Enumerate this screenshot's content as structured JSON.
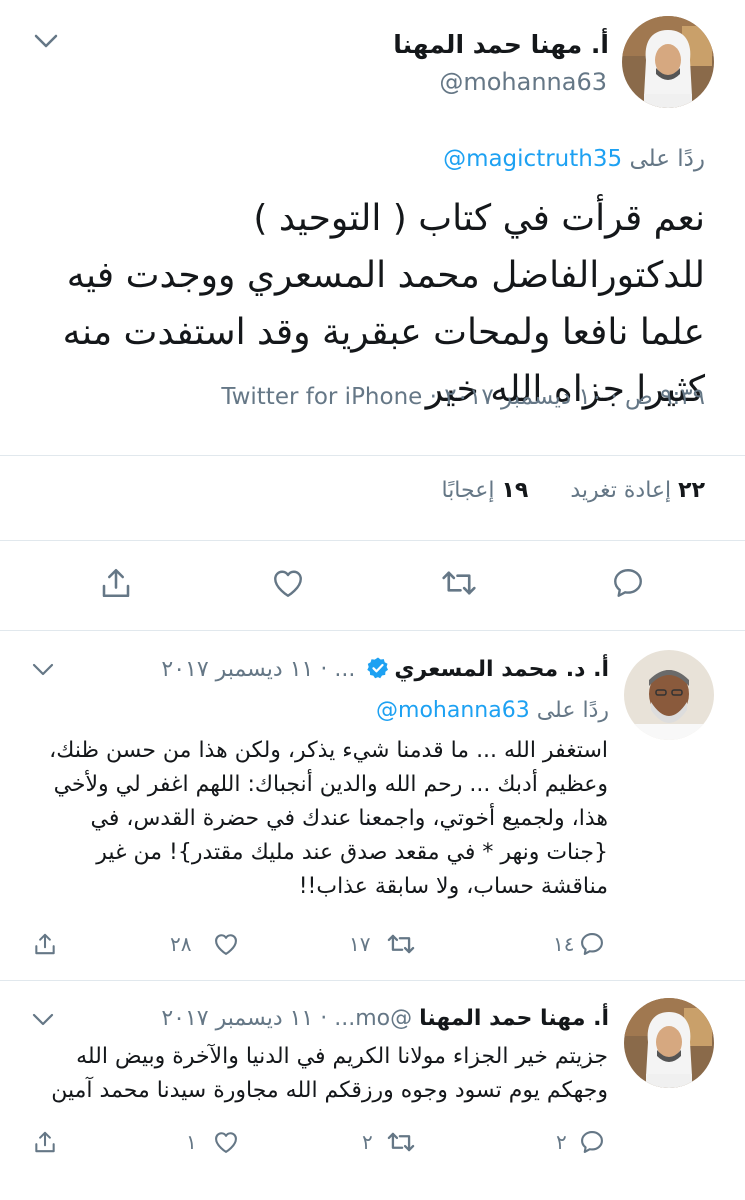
{
  "main_tweet": {
    "display_name": "أ. مهنا حمد المهنا",
    "handle": "@mohanna63",
    "reply_prefix": "ردًا على",
    "reply_to": "magictruth35@",
    "text": "نعم قرأت في كتاب ( التوحيد ) للدكتورالفاضل محمد المسعري ووجدت فيه علما نافعا ولمحات عبقرية وقد استفدت منه كثيرا جزاه الله خير",
    "meta": "٩:٣٩ ص · ١٠ ديسمبر ٢٠١٧ · Twitter for iPhone",
    "retweets_count": "٢٢",
    "retweets_label": "إعادة تغريد",
    "likes_count": "١٩",
    "likes_label": "إعجابًا"
  },
  "replies": [
    {
      "display_name": "أ. د. محمد المسعري",
      "verified": true,
      "handle_date": "... · ١١ ديسمبر ٢٠١٧",
      "reply_prefix": "ردًا على",
      "reply_to": "mohanna63@",
      "text": "استغفر الله ... ما قدمنا شيء يذكر، ولكن هذا من حسن ظنك، وعظيم أدبك ... رحم الله والدين أنجباك: اللهم اغفر لي ولأخي هذا، ولجميع أخوتي، واجمعنا عندك في حضرة القدس، في {جنات ونهر * في مقعد صدق عند مليك مقتدر}! من غير مناقشة حساب، ولا سابقة عذاب!!",
      "reply_count": "١٤",
      "retweet_count": "١٧",
      "like_count": "٢٨"
    },
    {
      "display_name": "أ. مهنا حمد المهنا",
      "verified": false,
      "handle_date": "@mo... · ١١ ديسمبر ٢٠١٧",
      "text": "جزيتم خير الجزاء مولانا الكريم في الدنيا والآخرة وبيض الله وجهكم يوم تسود وجوه ورزقكم الله مجاورة سيدنا محمد آمين",
      "reply_count": "٢",
      "retweet_count": "٢",
      "like_count": "١"
    }
  ],
  "icons": {
    "chevron": "chevron-down-icon",
    "reply": "reply-icon",
    "retweet": "retweet-icon",
    "like": "heart-icon",
    "share": "share-icon",
    "verified": "verified-badge-icon"
  },
  "colors": {
    "link": "#1da1f2",
    "muted": "#657786",
    "text": "#14171a",
    "separator": "#e1e8ed",
    "icon": "#657786"
  }
}
